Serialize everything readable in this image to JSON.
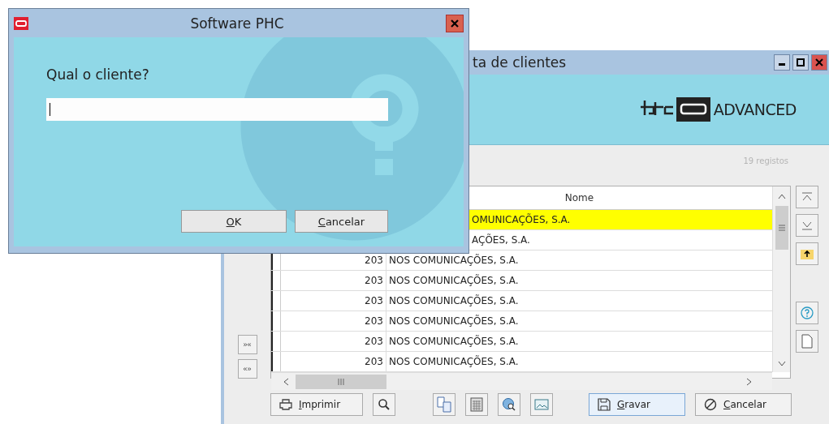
{
  "back_window": {
    "title": "ta de clientes",
    "logo_text": "ADVANCED",
    "record_count": "19 registos",
    "columns": [
      "Nome"
    ],
    "rows": [
      {
        "name": "OMUNICAÇÕES, S.A.",
        "covered": true,
        "selected": true
      },
      {
        "name": "AÇÕES, S.A.",
        "covered": true,
        "selected": false
      },
      {
        "code": "203",
        "name": "NOS COMUNICAÇÕES, S.A.",
        "selected": false
      },
      {
        "code": "203",
        "name": "NOS COMUNICAÇÕES, S.A.",
        "selected": false
      },
      {
        "code": "203",
        "name": "NOS COMUNICAÇÕES, S.A.",
        "selected": false
      },
      {
        "code": "203",
        "name": "NOS COMUNICAÇÕES, S.A.",
        "selected": false
      },
      {
        "code": "203",
        "name": "NOS COMUNICAÇÕES, S.A.",
        "selected": false
      },
      {
        "code": "203",
        "name": "NOS COMUNICAÇÕES, S.A.",
        "selected": false
      }
    ],
    "side_buttons": [
      "»«",
      "«»"
    ],
    "toolbar": [
      {
        "kind": "text",
        "label": "Imprimir"
      },
      {
        "kind": "icon"
      },
      {
        "kind": "icon"
      },
      {
        "kind": "icon"
      },
      {
        "kind": "icon"
      },
      {
        "kind": "icon"
      },
      {
        "kind": "text",
        "label": "Gravar"
      },
      {
        "kind": "text",
        "label": "Cancelar"
      }
    ]
  },
  "dialog": {
    "title": "Software PHC",
    "prompt": "Qual o cliente?",
    "input": {
      "focused": true
    },
    "buttons": [
      {
        "label": "OK"
      },
      {
        "label": "Cancelar"
      }
    ]
  }
}
